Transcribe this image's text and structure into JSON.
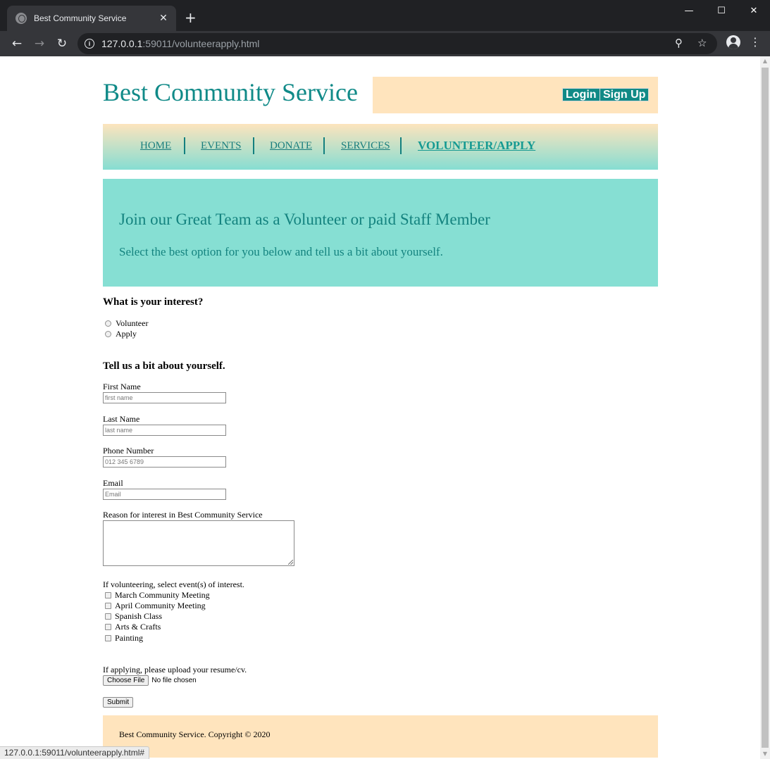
{
  "browser": {
    "tab_title": "Best Community Service",
    "url_host": "127.0.0.1",
    "url_rest": ":59011/volunteerapply.html",
    "status_url": "127.0.0.1:59011/volunteerapply.html#"
  },
  "header": {
    "site_title": "Best Community Service",
    "login_label": "Login",
    "signup_label": "Sign Up"
  },
  "nav": {
    "items": [
      {
        "label": "HOME"
      },
      {
        "label": "EVENTS"
      },
      {
        "label": "DONATE"
      },
      {
        "label": "SERVICES"
      },
      {
        "label": "VOLUNTEER/APPLY"
      }
    ]
  },
  "hero": {
    "title": "Join our Great Team as a Volunteer or paid Staff Member",
    "subtitle": "Select the best option for you below and tell us a bit about yourself."
  },
  "form": {
    "interest_heading": "What is your interest?",
    "interest_options": [
      "Volunteer",
      "Apply"
    ],
    "about_heading": "Tell us a bit about yourself.",
    "first_name": {
      "label": "First Name",
      "placeholder": "first name"
    },
    "last_name": {
      "label": "Last Name",
      "placeholder": "last name"
    },
    "phone": {
      "label": "Phone Number",
      "placeholder": "012 345 6789"
    },
    "email": {
      "label": "Email",
      "placeholder": "Email"
    },
    "reason_label": "Reason for interest in Best Community Service",
    "events_label": "If volunteering, select event(s) of interest.",
    "events": [
      "March Community Meeting",
      "April Community Meeting",
      "Spanish Class",
      "Arts & Crafts",
      "Painting"
    ],
    "upload_label": "If applying, please upload your resume/cv.",
    "choose_file_label": "Choose File",
    "no_file_text": "No file chosen",
    "submit_label": "Submit"
  },
  "footer": {
    "text": "Best Community Service. Copyright © 2020"
  },
  "colors": {
    "brand_teal": "#108a88",
    "accent_peach": "#ffe4bd",
    "hero_teal": "#86dfd3"
  }
}
